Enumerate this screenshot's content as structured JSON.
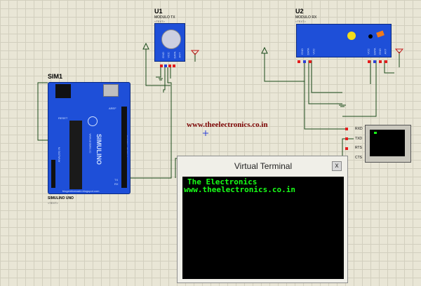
{
  "components": {
    "u1": {
      "ref": "U1",
      "name": "MODULO TX",
      "text": "<TEXT>",
      "pins": [
        "GND",
        "VCC",
        "DATA",
        "ANT"
      ]
    },
    "u2": {
      "ref": "U2",
      "name": "MODULO RX",
      "text": "<TEXT>",
      "pins": [
        "GND",
        "DATA",
        "VCC",
        "VCC",
        "DATA",
        "GND",
        "ANT"
      ]
    },
    "sim1": {
      "ref": "SIM1",
      "name": "SIMULINO UNO",
      "text": "<TEXT>",
      "brand": "SIMULINO",
      "site": "www.arduino.cc",
      "footer": "blogembarcado.blogspot.com",
      "labels": [
        "AREF",
        "ANALOG IN",
        "DIGITAL (PWM~)",
        "RESET",
        "TX",
        "RX"
      ]
    },
    "terminal_symbol": {
      "pins": [
        "RXD",
        "TXD",
        "RTS",
        "CTS"
      ]
    }
  },
  "site_label": "www.theelectronics.co.in",
  "virtual_terminal": {
    "title": "Virtual Terminal",
    "close_glyph": "x",
    "lines": [
      "The Electronics",
      "www.theelectronics.co.in"
    ]
  },
  "colors": {
    "wire": "#1a4a1a",
    "board": "#1e4fd8",
    "terminal_text": "#18ff18",
    "site_text": "#7a0000"
  }
}
